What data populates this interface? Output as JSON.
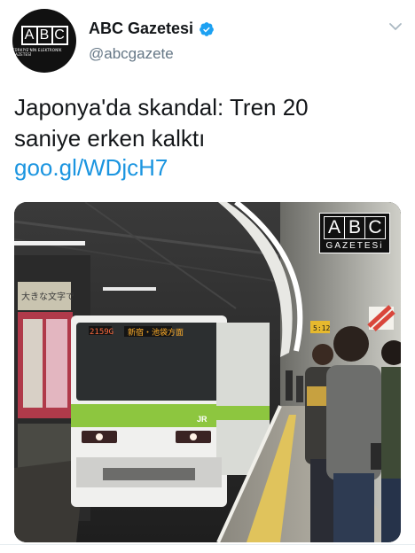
{
  "account": {
    "display_name": "ABC Gazetesi",
    "handle": "@abcgazete",
    "verified": true,
    "avatar_letters": [
      "A",
      "B",
      "C"
    ],
    "avatar_subtitle": "TÜRKİYE'NİN ELEKTRONİK GAZETESİ"
  },
  "tweet": {
    "text_line1": "Japonya'da skandal: Tren 20",
    "text_line2": "saniye erken kalktı",
    "link": "goo.gl/WDjcH7"
  },
  "media": {
    "watermark_letters": [
      "A",
      "B",
      "C"
    ],
    "watermark_subtitle": "GAZETESi",
    "train_number": "2159G",
    "destination_sign": "新宿・池袋方面",
    "train_logo": "JR",
    "station_sign": "大きな文字で",
    "clock": "5:12"
  },
  "colors": {
    "link": "#1b95e0",
    "verified": "#1da1f2",
    "text": "#14171a",
    "secondary": "#657786"
  },
  "icons": [
    "verified-badge-icon",
    "chevron-down-icon"
  ]
}
